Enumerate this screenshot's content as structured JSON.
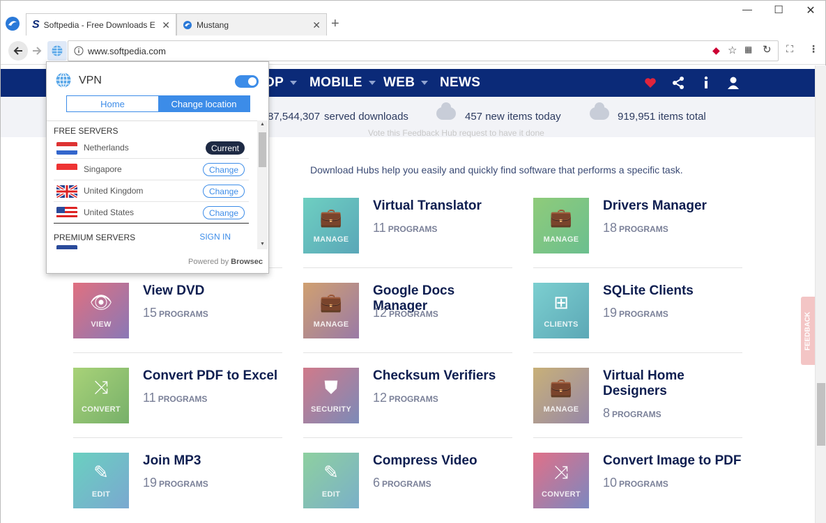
{
  "browser": {
    "tabs": [
      {
        "title": "Softpedia - Free Downloads Enc",
        "active": true
      },
      {
        "title": "Mustang",
        "active": false
      }
    ],
    "url": "www.softpedia.com"
  },
  "site": {
    "nav": [
      "DESKTOP",
      "MOBILE",
      "WEB",
      "NEWS"
    ],
    "nav_partial_first": "OP",
    "stats": {
      "served": "87,544,307",
      "served_label": "served downloads",
      "new_items": "457 new items today",
      "total_items": "919,951 items total"
    },
    "feedback_ghost": "Vote this Feedback Hub request to have it done",
    "hubs_description": "Download Hubs help you easily and quickly find software that performs a specific task.",
    "programs_label": "PROGRAMS",
    "feedback_tab": "FEEDBACK",
    "hubs": [
      {
        "title": "Virtual Translator",
        "count": "11",
        "caption": "MANAGE",
        "icon": "briefcase-icon"
      },
      {
        "title": "Drivers Manager",
        "count": "18",
        "caption": "MANAGE",
        "icon": "briefcase-icon"
      },
      {
        "title": "View DVD",
        "count": "15",
        "caption": "VIEW",
        "icon": "eye-icon"
      },
      {
        "title": "Google Docs Manager",
        "count": "12",
        "caption": "MANAGE",
        "icon": "briefcase-icon"
      },
      {
        "title": "SQLite Clients",
        "count": "19",
        "caption": "CLIENTS",
        "icon": "network-icon"
      },
      {
        "title": "Convert PDF to Excel",
        "count": "11",
        "caption": "CONVERT",
        "icon": "shuffle-icon"
      },
      {
        "title": "Checksum Verifiers",
        "count": "12",
        "caption": "SECURITY",
        "icon": "shield-icon"
      },
      {
        "title": "Virtual Home Designers",
        "count": "8",
        "caption": "MANAGE",
        "icon": "briefcase-icon"
      },
      {
        "title": "Join MP3",
        "count": "19",
        "caption": "EDIT",
        "icon": "edit-icon"
      },
      {
        "title": "Compress Video",
        "count": "6",
        "caption": "EDIT",
        "icon": "edit-icon"
      },
      {
        "title": "Convert Image to PDF",
        "count": "10",
        "caption": "CONVERT",
        "icon": "shuffle-icon"
      }
    ]
  },
  "vpn": {
    "title": "VPN",
    "tab_home": "Home",
    "tab_change": "Change location",
    "free_header": "FREE SERVERS",
    "premium_header": "PREMIUM SERVERS",
    "sign_in": "SIGN IN",
    "servers": [
      {
        "country": "Netherlands",
        "action": "Current"
      },
      {
        "country": "Singapore",
        "action": "Change"
      },
      {
        "country": "United Kingdom",
        "action": "Change"
      },
      {
        "country": "United States",
        "action": "Change"
      }
    ],
    "powered_prefix": "Powered by",
    "powered_brand": "Browsec"
  },
  "colors": {
    "nav_bg": "#0b2a78",
    "accent": "#3c8ce8",
    "heart": "#e0243c"
  }
}
